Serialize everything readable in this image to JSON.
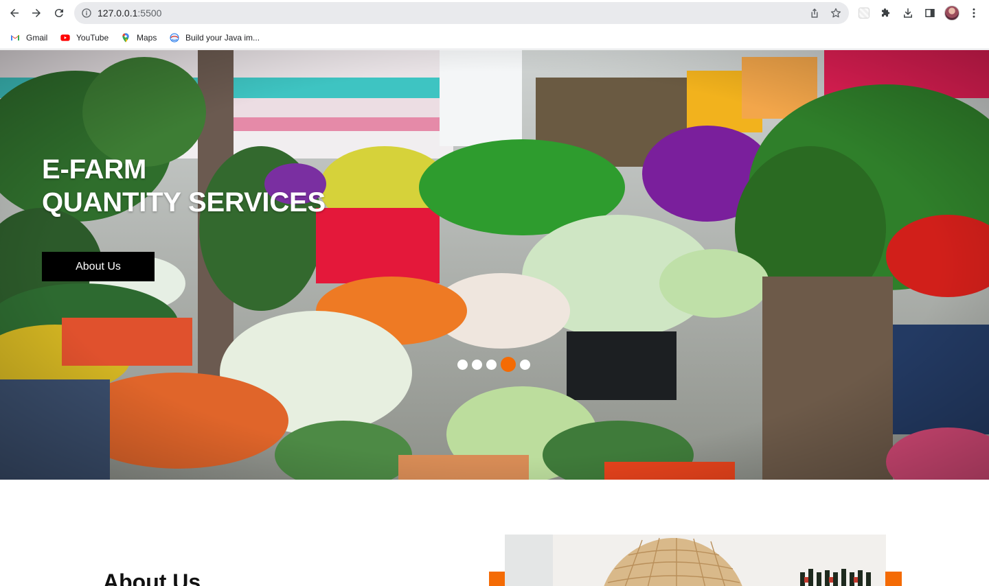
{
  "browser": {
    "url_host": "127.0.0.1",
    "url_port": ":5500",
    "bookmarks": [
      {
        "label": "Gmail",
        "icon": "gmail-icon"
      },
      {
        "label": "YouTube",
        "icon": "youtube-icon"
      },
      {
        "label": "Maps",
        "icon": "maps-icon"
      },
      {
        "label": "Build your Java im...",
        "icon": "globe-icon"
      }
    ]
  },
  "hero": {
    "title_line1": "E-FARM",
    "title_line2": "QUANTITY SERVICES",
    "button_label": "About Us",
    "slide_count": 5,
    "active_slide": 4,
    "image": "market-produce-stall"
  },
  "about": {
    "heading": "About Us",
    "image": "wicker-lamp-interior"
  },
  "colors": {
    "accent": "#f46b05",
    "button_bg": "#000000",
    "chrome_omnibox": "#e9eaed"
  }
}
